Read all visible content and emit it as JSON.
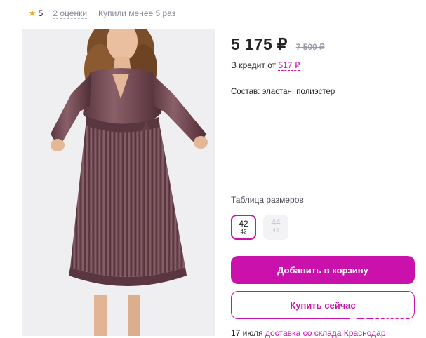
{
  "rating": {
    "score": "5",
    "reviews": "2 оценки",
    "bought": "Купили менее 5 раз"
  },
  "product": {
    "price": "5 175 ₽",
    "old_price": "7 500 ₽",
    "credit_prefix": "В кредит от ",
    "credit_amount": "517 ₽",
    "composition": "Состав: эластан, полиэстер"
  },
  "sizes": {
    "table_link": "Таблица размеров",
    "items": [
      {
        "size": "42",
        "ru": "42",
        "selected": true
      },
      {
        "size": "44",
        "ru": "44",
        "available": false
      }
    ]
  },
  "actions": {
    "add_to_cart": "Добавить в корзину",
    "buy_now": "Купить сейчас"
  },
  "delivery": {
    "date": "17 июля",
    "place": "доставка со склада Краснодар"
  },
  "watermark": "Avito",
  "colors": {
    "accent": "#cb11ab",
    "dress": "#6e4650",
    "star": "#f5a623"
  }
}
